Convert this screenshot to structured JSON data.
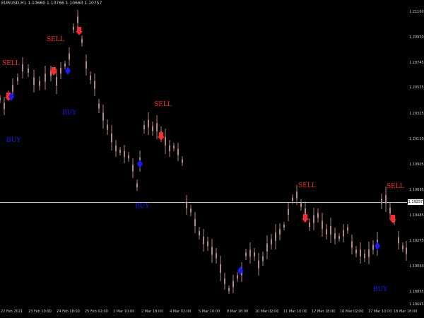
{
  "header": {
    "symbol_info": "EURUSD,H1  1.10660 1.10766 1.10660 1.10757"
  },
  "colors": {
    "background": "#000000",
    "candle": "#b58585",
    "sell": "#ff2a2a",
    "buy": "#1a1aff",
    "price_line": "#c0c0c0",
    "axis_text": "#c8c8c8"
  },
  "price_axis": {
    "labels": [
      "1.21160",
      "1.20950",
      "1.20745",
      "1.20535",
      "1.20325",
      "1.20110",
      "1.19905",
      "1.19695",
      "1.19485",
      "1.19275",
      "1.19060",
      "1.18855",
      "1.18645"
    ],
    "current_price": "1.19257"
  },
  "time_axis": {
    "labels": [
      "22 Feb 2021",
      "23 Feb 10:00",
      "24 Feb 18:00",
      "25 Feb 02:00",
      "1 Mar 10:00",
      "2 Mar 18:00",
      "4 Mar 02:00",
      "5 Mar 10:00",
      "8 Mar 18:00",
      "10 Mar 02:00",
      "11 Mar 10:00",
      "12 Mar 18:00",
      "16 Mar 02:00",
      "17 Mar 10:00",
      "18 Mar 18:00"
    ]
  },
  "signals": [
    {
      "type": "SELL",
      "text": "SELL"
    },
    {
      "type": "SELL",
      "text": "SELL"
    },
    {
      "type": "SELL",
      "text": "SELL"
    },
    {
      "type": "SELL",
      "text": "SELL"
    },
    {
      "type": "SELL",
      "text": "SELL"
    },
    {
      "type": "BUY",
      "text": "BUY"
    },
    {
      "type": "BUY",
      "text": "BUY"
    },
    {
      "type": "BUY",
      "text": "BUY"
    },
    {
      "type": "BUY",
      "text": "BUY"
    }
  ]
}
